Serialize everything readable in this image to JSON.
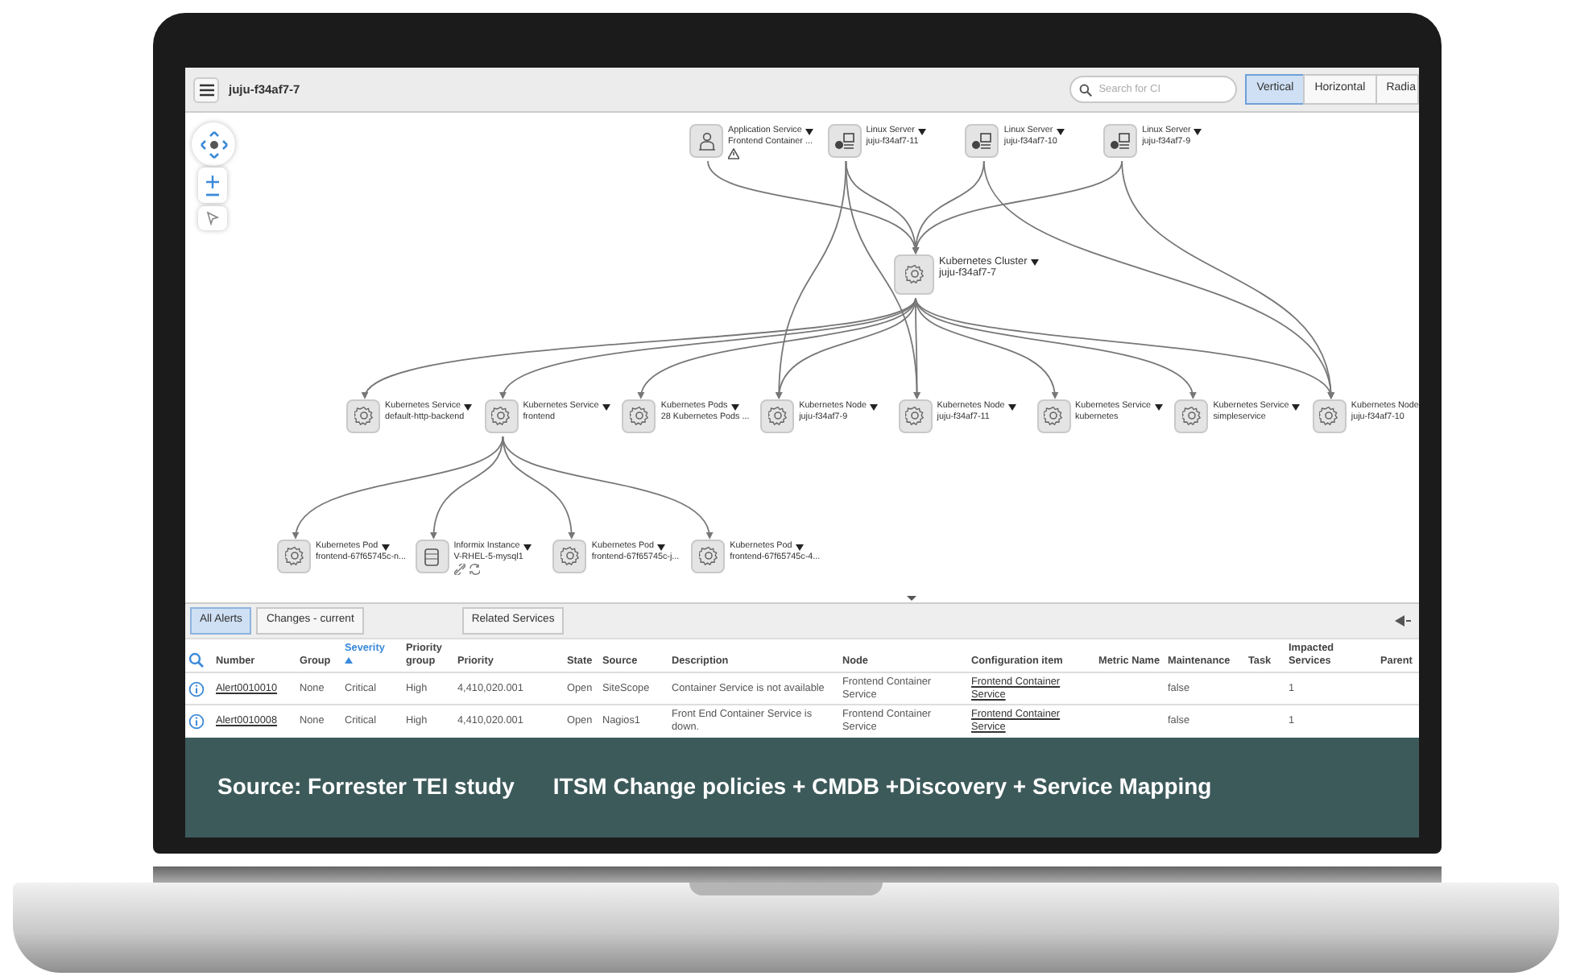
{
  "toolbar": {
    "title": "juju-f34af7-7",
    "search": {
      "placeholder": "Search for CI"
    },
    "layouts": [
      {
        "label": "Vertical",
        "selected": true
      },
      {
        "label": "Horizontal",
        "selected": false
      },
      {
        "label": "Radia",
        "selected": false
      }
    ]
  },
  "graph": {
    "tiers": [
      [
        {
          "type": "Application Service",
          "name": "Frontend Container ...",
          "kind": "person",
          "warning": true,
          "ci_links": false
        },
        {
          "type": "Linux Server",
          "name": "juju-f34af7-11",
          "kind": "server",
          "warning": false,
          "ci_links": false
        },
        {
          "type": "Linux Server",
          "name": "juju-f34af7-10",
          "kind": "server",
          "warning": false,
          "ci_links": false
        },
        {
          "type": "Linux Server",
          "name": "juju-f34af7-9",
          "kind": "server",
          "warning": false,
          "ci_links": false
        }
      ],
      [
        {
          "type": "Kubernetes Cluster",
          "name": "juju-f34af7-7",
          "kind": "gear",
          "warning": false,
          "ci_links": false
        }
      ],
      [
        {
          "type": "Kubernetes Service",
          "name": "default-http-backend",
          "kind": "gear",
          "warning": false,
          "ci_links": false
        },
        {
          "type": "Kubernetes Service",
          "name": "frontend",
          "kind": "gear",
          "warning": false,
          "ci_links": false
        },
        {
          "type": "Kubernetes Pods",
          "name": "28 Kubernetes Pods ...",
          "kind": "gear",
          "warning": false,
          "ci_links": false
        },
        {
          "type": "Kubernetes Node",
          "name": "juju-f34af7-9",
          "kind": "gear",
          "warning": false,
          "ci_links": false
        },
        {
          "type": "Kubernetes Node",
          "name": "juju-f34af7-11",
          "kind": "gear",
          "warning": false,
          "ci_links": false
        },
        {
          "type": "Kubernetes Service",
          "name": "kubernetes",
          "kind": "gear",
          "warning": false,
          "ci_links": false
        },
        {
          "type": "Kubernetes Service",
          "name": "simpleservice",
          "kind": "gear",
          "warning": false,
          "ci_links": false
        },
        {
          "type": "Kubernetes Node",
          "name": "juju-f34af7-10",
          "kind": "gear",
          "warning": false,
          "ci_links": false
        }
      ],
      [
        {
          "type": "Kubernetes Pod",
          "name": "frontend-67f65745c-n...",
          "kind": "gear",
          "warning": false,
          "ci_links": false
        },
        {
          "type": "Informix Instance",
          "name": "V-RHEL-5-mysql1",
          "kind": "database",
          "warning": false,
          "ci_links": true
        },
        {
          "type": "Kubernetes Pod",
          "name": "frontend-67f65745c-j...",
          "kind": "gear",
          "warning": false,
          "ci_links": false
        },
        {
          "type": "Kubernetes Pod",
          "name": "frontend-67f65745c-4...",
          "kind": "gear",
          "warning": false,
          "ci_links": false
        }
      ]
    ]
  },
  "panel_tabs": [
    {
      "label": "All Alerts",
      "selected": true
    },
    {
      "label": "Changes - current",
      "selected": false
    },
    {
      "label": "Related Services",
      "selected": false
    }
  ],
  "table": {
    "columns": [
      {
        "label": "Number",
        "sorted": false,
        "kind": "link"
      },
      {
        "label": "Group",
        "sorted": false,
        "kind": "text"
      },
      {
        "label": "Severity",
        "sorted": true,
        "kind": "text"
      },
      {
        "label": "Priority group",
        "sorted": false,
        "kind": "text"
      },
      {
        "label": "Priority",
        "sorted": false,
        "kind": "text"
      },
      {
        "label": "State",
        "sorted": false,
        "kind": "text"
      },
      {
        "label": "Source",
        "sorted": false,
        "kind": "text"
      },
      {
        "label": "Description",
        "sorted": false,
        "kind": "text"
      },
      {
        "label": "Node",
        "sorted": false,
        "kind": "text"
      },
      {
        "label": "Configuration item",
        "sorted": false,
        "kind": "link"
      },
      {
        "label": "Metric Name",
        "sorted": false
      },
      {
        "label": "Maintenance",
        "sorted": false,
        "kind": "text"
      },
      {
        "label": "Task",
        "sorted": false
      },
      {
        "label": "Impacted Services",
        "sorted": false,
        "kind": "text"
      },
      {
        "label": "Parent",
        "sorted": false
      }
    ],
    "rows": [
      [
        "Alert0010010",
        "None",
        "Critical",
        "High",
        "4,410,020.001",
        "Open",
        "SiteScope",
        "Container Service is not available",
        "Frontend Container Service",
        "Frontend Container Service",
        "",
        "false",
        "",
        "1",
        ""
      ],
      [
        "Alert0010008",
        "None",
        "Critical",
        "High",
        "4,410,020.001",
        "Open",
        "Nagios1",
        "Front End Container Service is down.",
        "Frontend Container Service",
        "Frontend Container Service",
        "",
        "false",
        "",
        "1",
        ""
      ]
    ]
  },
  "caption": [
    "Source: Forrester TEI study",
    "ITSM Change policies + CMDB +Discovery + Service Mapping"
  ]
}
